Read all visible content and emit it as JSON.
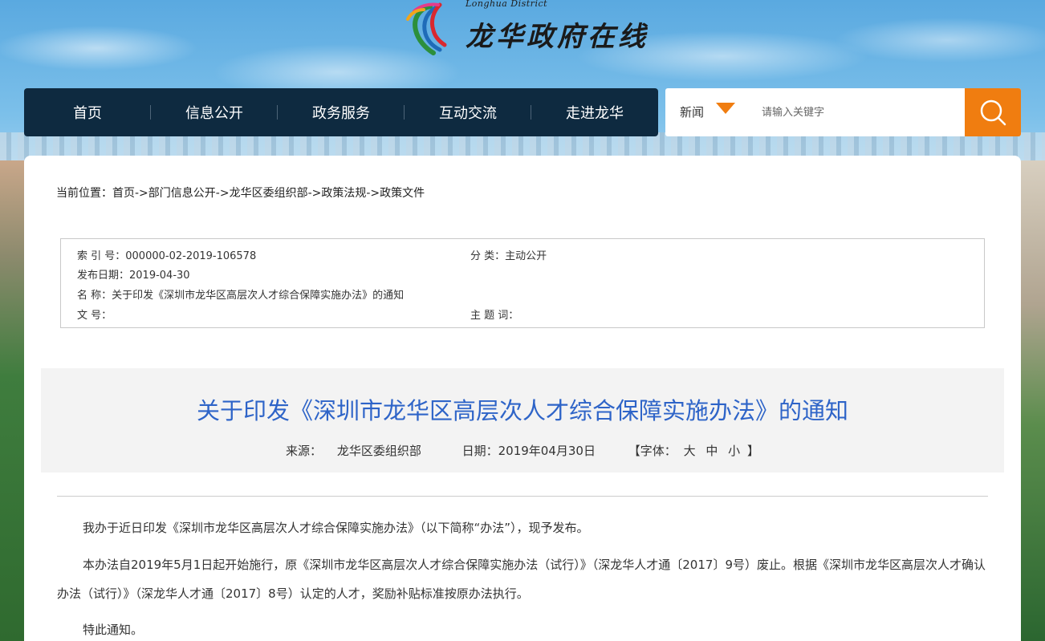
{
  "header": {
    "logo_subtitle": "Longhua District",
    "logo_title": "龙华政府在线"
  },
  "nav": {
    "items": [
      "首页",
      "信息公开",
      "政务服务",
      "互动交流",
      "走进龙华"
    ]
  },
  "search": {
    "category": "新闻",
    "placeholder": "请输入关键字",
    "icon": "search-icon",
    "accent": "#f07d10"
  },
  "breadcrumb": "当前位置：首页->部门信息公开->龙华区委组织部->政策法规->政策文件",
  "meta": {
    "index_label": "索 引 号：",
    "index_value": "000000-02-2019-106578",
    "category_label": "分 类：",
    "category_value": "主动公开",
    "date_label": "发布日期：",
    "date_value": "2019-04-30",
    "name_label": "名 称：",
    "name_value": "关于印发《深圳市龙华区高层次人才综合保障实施办法》的通知",
    "docno_label": "文 号：",
    "docno_value": "",
    "keywords_label": "主 题 词：",
    "keywords_value": ""
  },
  "document": {
    "title": "关于印发《深圳市龙华区高层次人才综合保障实施办法》的通知",
    "source_label": "来源：",
    "source_value": "龙华区委组织部",
    "date_label": "日期：",
    "date_value": "2019年04月30日",
    "font_label": "【字体：",
    "font_large": "大",
    "font_medium": "中",
    "font_small": "小",
    "font_close": "】",
    "paragraphs": [
      "我办于近日印发《深圳市龙华区高层次人才综合保障实施办法》（以下简称“办法”），现予发布。",
      "本办法自2019年5月1日起开始施行，原《深圳市龙华区高层次人才综合保障实施办法（试行）》（深龙华人才通〔2017〕9号）废止。根据《深圳市龙华区高层次人才确认办法（试行）》（深龙华人才通〔2017〕8号）认定的人才，奖励补贴标准按原办法执行。",
      "特此通知。"
    ]
  },
  "colors": {
    "nav_bg": "#0e2a40",
    "title_color": "#2e64c8"
  }
}
